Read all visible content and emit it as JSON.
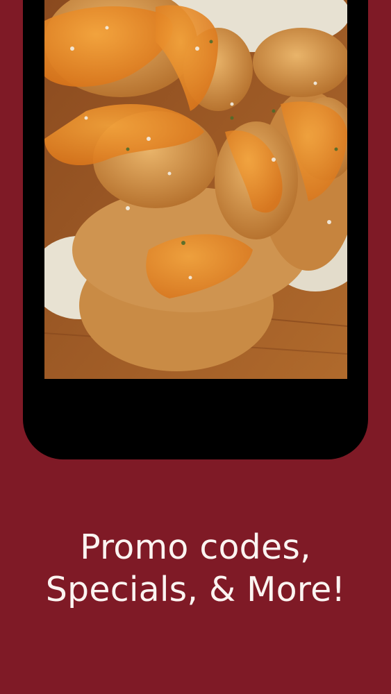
{
  "screen": {
    "image_description_icon": "fried-shrimp-po-boy-photo"
  },
  "caption": {
    "line1": "Promo codes,",
    "line2": "Specials, & More!"
  },
  "colors": {
    "background": "#7f1a26",
    "phone_frame": "#000000",
    "caption_text": "#fbf4f1"
  }
}
